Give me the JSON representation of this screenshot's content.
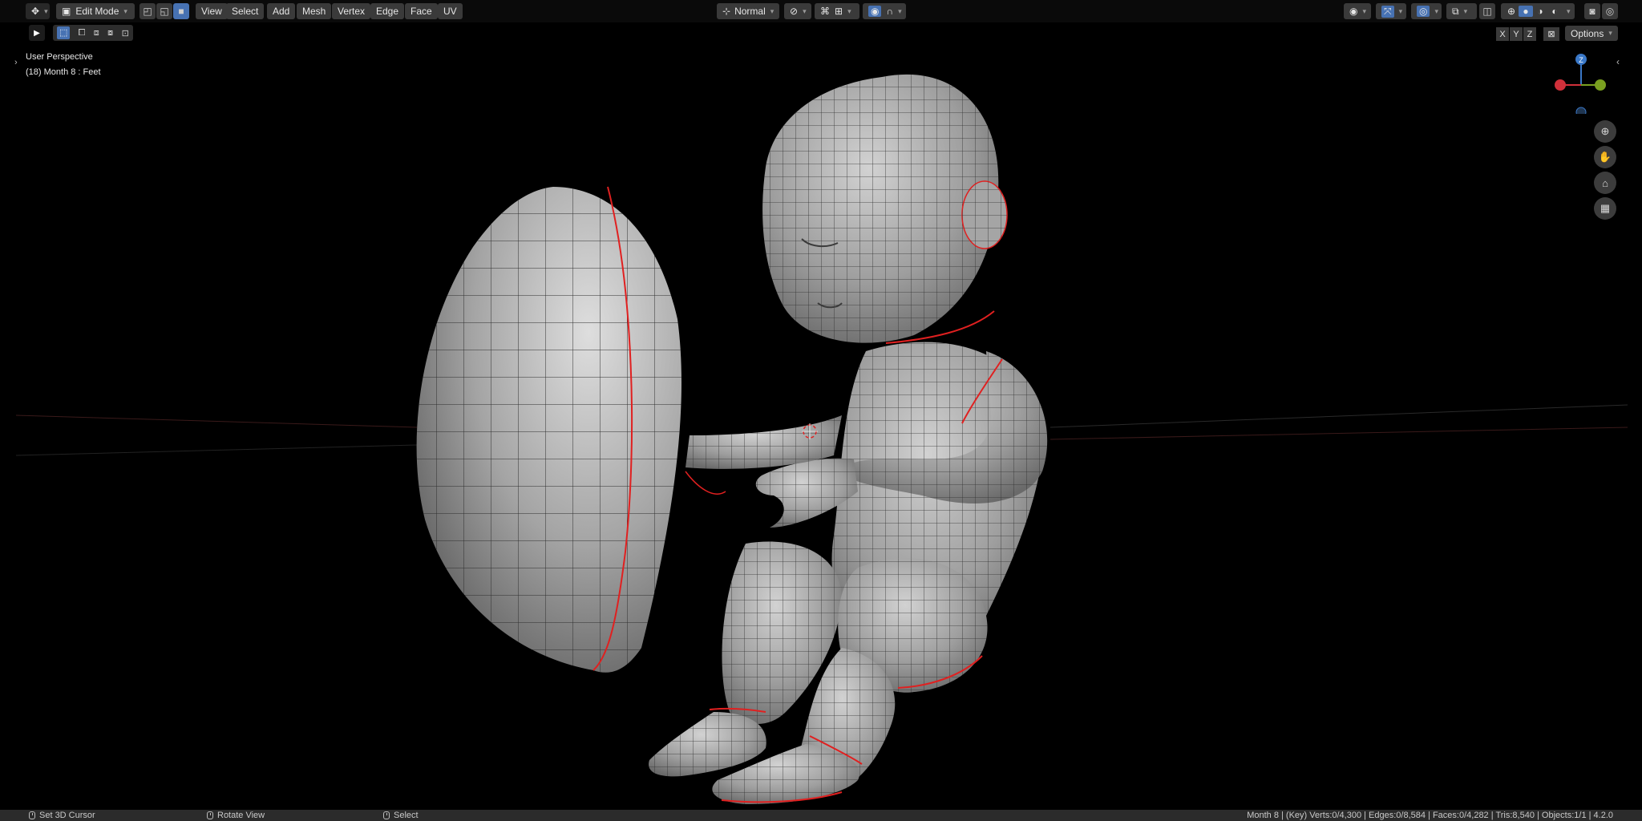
{
  "header": {
    "mode_label": "Edit Mode",
    "menus": [
      "View",
      "Select",
      "Add",
      "Mesh",
      "Vertex",
      "Edge",
      "Face",
      "UV"
    ],
    "orientation_label": "Normal",
    "options_label": "Options"
  },
  "viewport": {
    "view_name": "User Perspective",
    "object_info": "(18) Month 8 : Feet"
  },
  "gizmo": {
    "axes": [
      "X",
      "Y",
      "Z"
    ],
    "z_label": "Z"
  },
  "status": {
    "hints": [
      "Set 3D Cursor",
      "Rotate View",
      "Select"
    ],
    "stats": "Month 8 | (Key) Verts:0/4,300 | Edges:0/8,584 | Faces:0/4,282 | Tris:8,540 | Objects:1/1 | 4.2.0"
  },
  "icons": {
    "editor_type": "transform-gizmo-icon",
    "select_box": "select-box-icon",
    "zoom": "zoom-icon",
    "pan": "hand-icon",
    "camera": "camera-icon",
    "grid": "grid-icon"
  },
  "colors": {
    "accent": "#4772b3",
    "seam": "#e02020",
    "x_axis": "#d0303a",
    "y_axis": "#7aa020",
    "z_axis": "#3a78c8"
  }
}
